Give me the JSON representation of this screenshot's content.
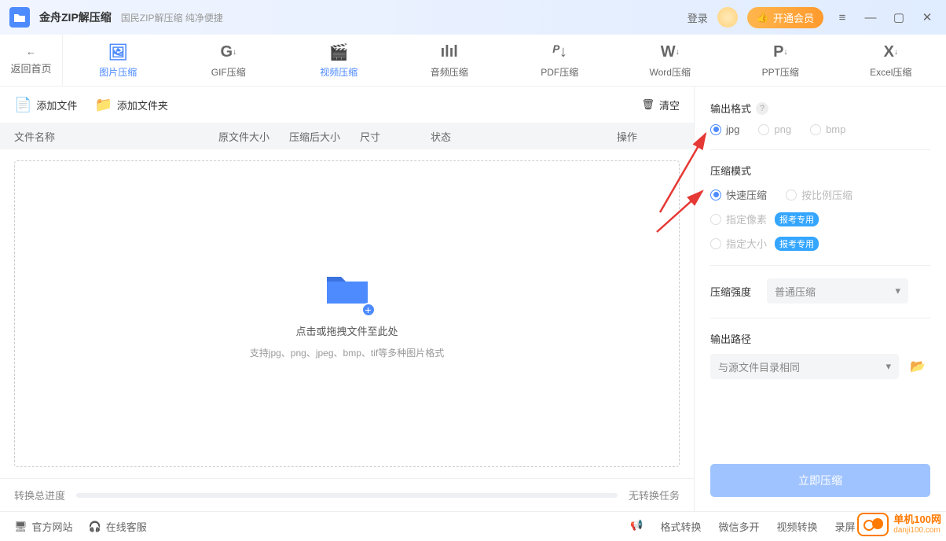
{
  "titlebar": {
    "app_title": "金舟ZIP解压缩",
    "app_subtitle": "国民ZIP解压缩 纯净便捷",
    "login": "登录",
    "vip": "开通会员"
  },
  "toolbar": {
    "back": "返回首页",
    "items": [
      {
        "label": "图片压缩",
        "active": true
      },
      {
        "label": "GIF压缩",
        "active": false
      },
      {
        "label": "视频压缩",
        "active": false
      },
      {
        "label": "音频压缩",
        "active": false
      },
      {
        "label": "PDF压缩",
        "active": false
      },
      {
        "label": "Word压缩",
        "active": false
      },
      {
        "label": "PPT压缩",
        "active": false
      },
      {
        "label": "Excel压缩",
        "active": false
      }
    ]
  },
  "file_actions": {
    "add_file": "添加文件",
    "add_folder": "添加文件夹",
    "clear": "清空"
  },
  "table_headers": {
    "name": "文件名称",
    "orig_size": "原文件大小",
    "comp_size": "压缩后大小",
    "dims": "尺寸",
    "status": "状态",
    "ops": "操作"
  },
  "dropzone": {
    "hint1": "点击或拖拽文件至此处",
    "hint2": "支持jpg、png、jpeg、bmp、tif等多种图片格式"
  },
  "progress": {
    "label": "转换总进度",
    "status": "无转换任务"
  },
  "side": {
    "output_format": "输出格式",
    "formats": [
      {
        "label": "jpg",
        "selected": true
      },
      {
        "label": "png",
        "selected": false
      },
      {
        "label": "bmp",
        "selected": false
      }
    ],
    "compress_mode": "压缩模式",
    "modes": [
      {
        "label": "快速压缩",
        "selected": true,
        "tag": null
      },
      {
        "label": "按比例压缩",
        "selected": false,
        "tag": null
      },
      {
        "label": "指定像素",
        "selected": false,
        "tag": "报考专用"
      },
      {
        "label": "指定大小",
        "selected": false,
        "tag": "报考专用"
      }
    ],
    "strength_label": "压缩强度",
    "strength_value": "普通压缩",
    "output_path_label": "输出路径",
    "output_path_value": "与源文件目录相同",
    "compress_btn": "立即压缩"
  },
  "footer": {
    "site": "官方网站",
    "support": "在线客服",
    "links": [
      "格式转换",
      "微信多开",
      "视频转换",
      "录屏"
    ]
  },
  "watermark": {
    "cn": "单机100网",
    "en": "danji100.com"
  }
}
